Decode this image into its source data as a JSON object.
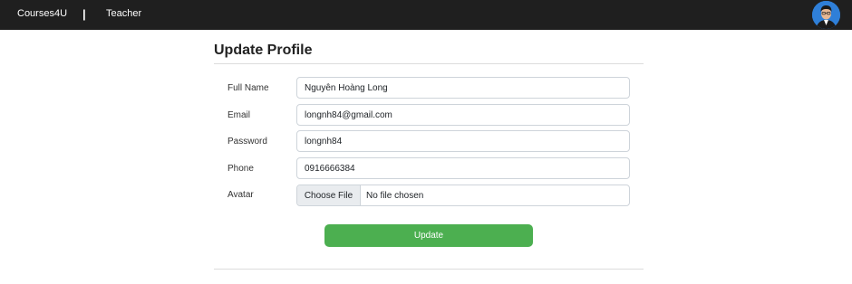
{
  "navbar": {
    "brand": "Courses4U",
    "separator": "|",
    "role": "Teacher"
  },
  "page": {
    "title": "Update Profile"
  },
  "form": {
    "full_name": {
      "label": "Full Name",
      "value": "Nguyễn Hoàng Long"
    },
    "email": {
      "label": "Email",
      "value": "longnh84@gmail.com"
    },
    "password": {
      "label": "Password",
      "value": "longnh84"
    },
    "phone": {
      "label": "Phone",
      "value": "0916666384"
    },
    "avatar": {
      "label": "Avatar",
      "button_label": "Choose File",
      "status": "No file chosen"
    },
    "submit_label": "Update"
  },
  "colors": {
    "navbar_bg": "#1f1f1f",
    "submit_bg": "#4caf50",
    "avatar_bg": "#2f7fd8"
  },
  "icons": {
    "user_avatar": "user-avatar-photo"
  }
}
